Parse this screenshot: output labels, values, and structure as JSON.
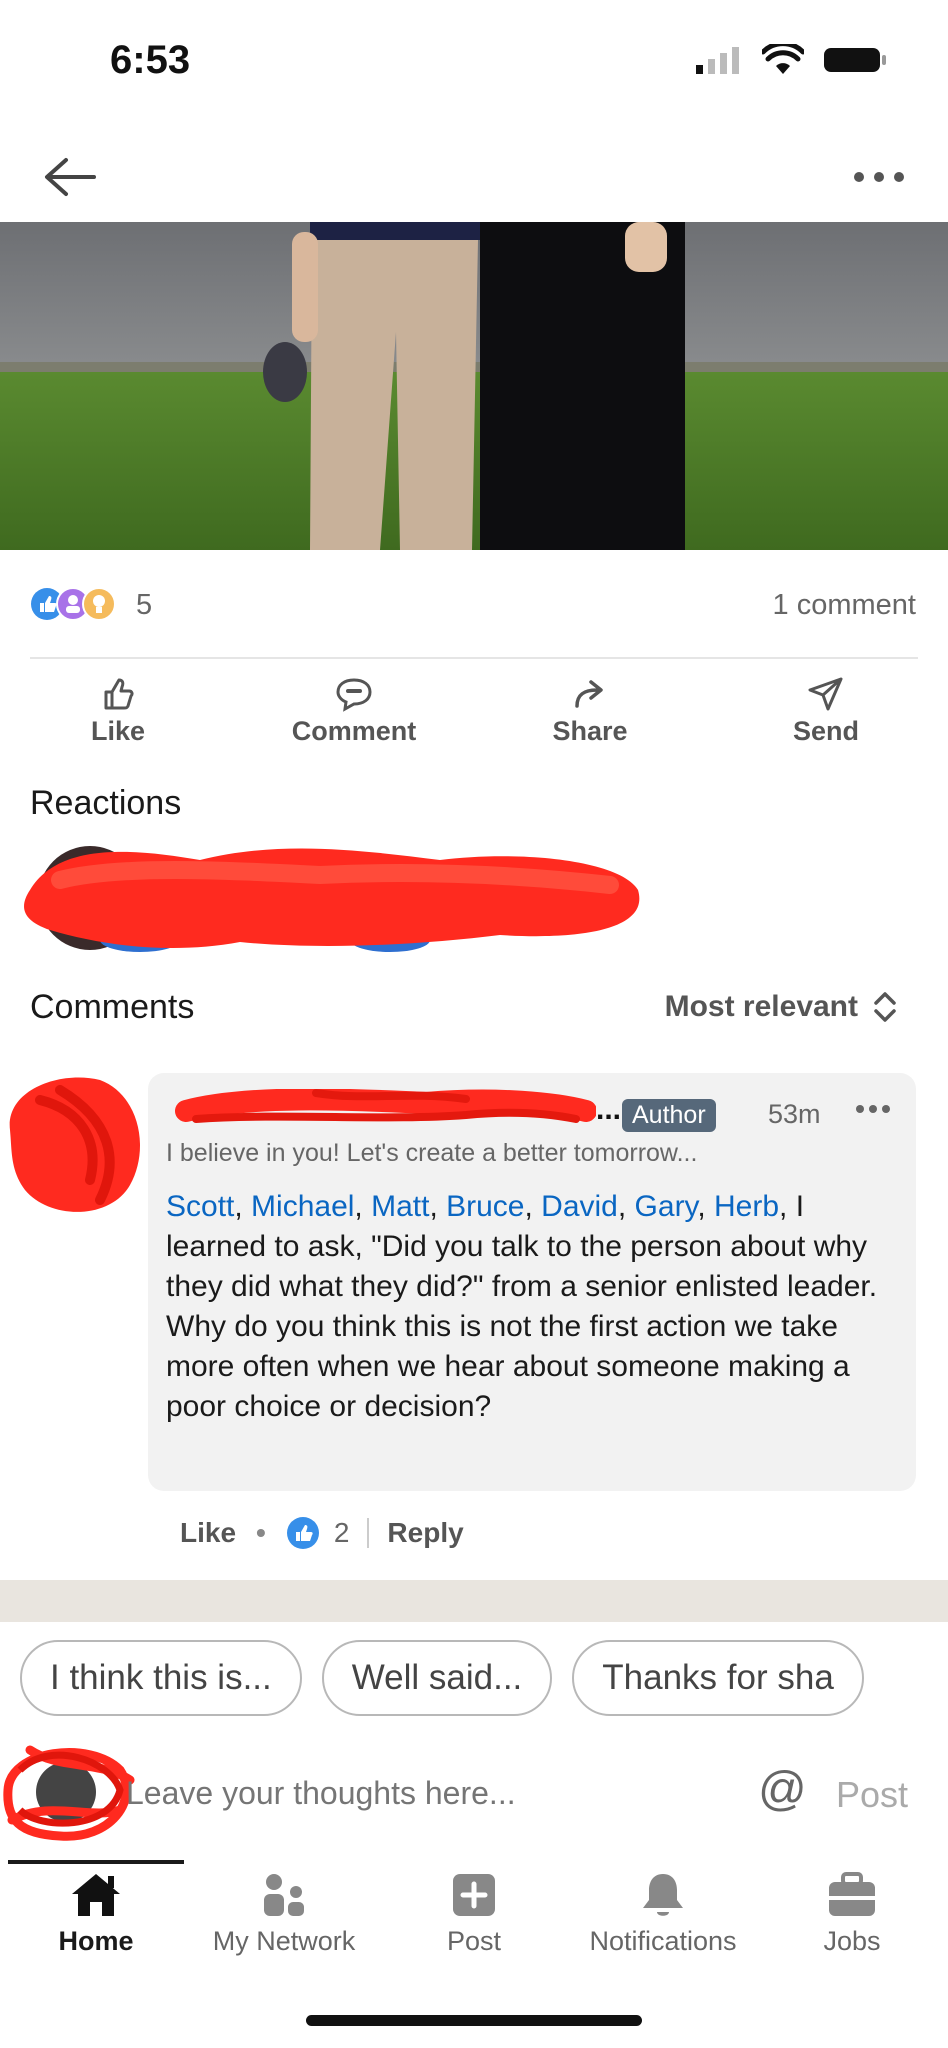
{
  "status_bar": {
    "time": "6:53"
  },
  "post": {
    "reaction_count": "5",
    "comment_count": "1 comment"
  },
  "actions": [
    {
      "label": "Like",
      "icon": "like-icon"
    },
    {
      "label": "Comment",
      "icon": "comment-icon"
    },
    {
      "label": "Share",
      "icon": "share-icon"
    },
    {
      "label": "Send",
      "icon": "send-icon"
    }
  ],
  "reactions_section": {
    "title": "Reactions"
  },
  "comments_section": {
    "title": "Comments",
    "sort_label": "Most relevant"
  },
  "comment": {
    "name_suffix": "...",
    "author_badge": "Author",
    "time": "53m",
    "headline": "I believe in you! Let's create a better tomorrow...",
    "mentions": [
      "Scott",
      "Michael",
      "Matt",
      "Bruce",
      "David",
      "Gary",
      "Herb"
    ],
    "text": ", I learned to ask, \"Did you talk to the person about why they did what they did?\" from a senior enlisted leader.  Why do you think this is not the first action we take more often when we hear about someone making a poor choice or decision?",
    "like_label": "Like",
    "like_count": "2",
    "reply_label": "Reply"
  },
  "suggestions": [
    "I think this is...",
    "Well said...",
    "Thanks for sha"
  ],
  "composer": {
    "placeholder": "Leave your thoughts here...",
    "mention_symbol": "@",
    "post_label": "Post"
  },
  "bottom_nav": [
    {
      "label": "Home",
      "icon": "home-icon",
      "active": true
    },
    {
      "label": "My Network",
      "icon": "network-icon",
      "active": false
    },
    {
      "label": "Post",
      "icon": "post-icon",
      "active": false
    },
    {
      "label": "Notifications",
      "icon": "bell-icon",
      "active": false
    },
    {
      "label": "Jobs",
      "icon": "briefcase-icon",
      "active": false
    }
  ],
  "colors": {
    "link": "#0a66c2",
    "redaction": "#ff2a1f",
    "badge": "#56687a",
    "grass": "#4e7d2a"
  }
}
